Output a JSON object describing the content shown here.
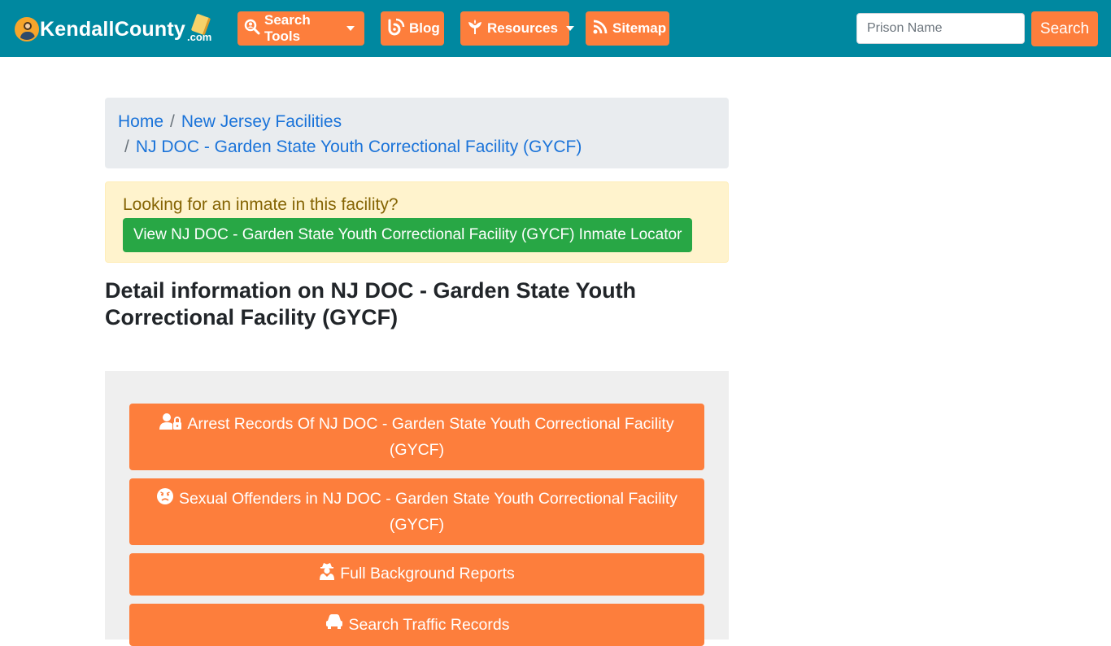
{
  "header": {
    "logo_text": "KendallCounty",
    "logo_suffix": ".com",
    "nav": [
      {
        "label": "Search Tools",
        "icon": "search-person-icon",
        "dropdown": true
      },
      {
        "label": "Blog",
        "icon": "blog-icon",
        "dropdown": false
      },
      {
        "label": "Resources",
        "icon": "leaf-icon",
        "dropdown": true
      },
      {
        "label": "Sitemap",
        "icon": "rss-icon",
        "dropdown": false
      }
    ],
    "search": {
      "placeholder": "Prison Name",
      "button_label": "Search"
    }
  },
  "breadcrumb": {
    "items": [
      "Home",
      "New Jersey Facilities",
      "NJ DOC - Garden State Youth Correctional Facility (GYCF)"
    ]
  },
  "alert": {
    "text": "Looking for an inmate in this facility?",
    "button_label": "View NJ DOC - Garden State Youth Correctional Facility (GYCF) Inmate Locator"
  },
  "main": {
    "heading": "Detail information on NJ DOC - Garden State Youth Correctional Facility (GYCF)",
    "actions": [
      {
        "label": "Arrest Records Of NJ DOC - Garden State Youth Correctional Facility (GYCF)",
        "icon": "user-lock-icon"
      },
      {
        "label": "Sexual Offenders in NJ DOC - Garden State Youth Correctional Facility (GYCF)",
        "icon": "angry-face-icon"
      },
      {
        "label": "Full Background Reports",
        "icon": "user-secret-icon"
      },
      {
        "label": "Search Traffic Records",
        "icon": "car-icon"
      }
    ]
  },
  "colors": {
    "navbar": "#0088a0",
    "accent": "#fd7e3c",
    "success": "#28a745",
    "link": "#1a73d9"
  }
}
